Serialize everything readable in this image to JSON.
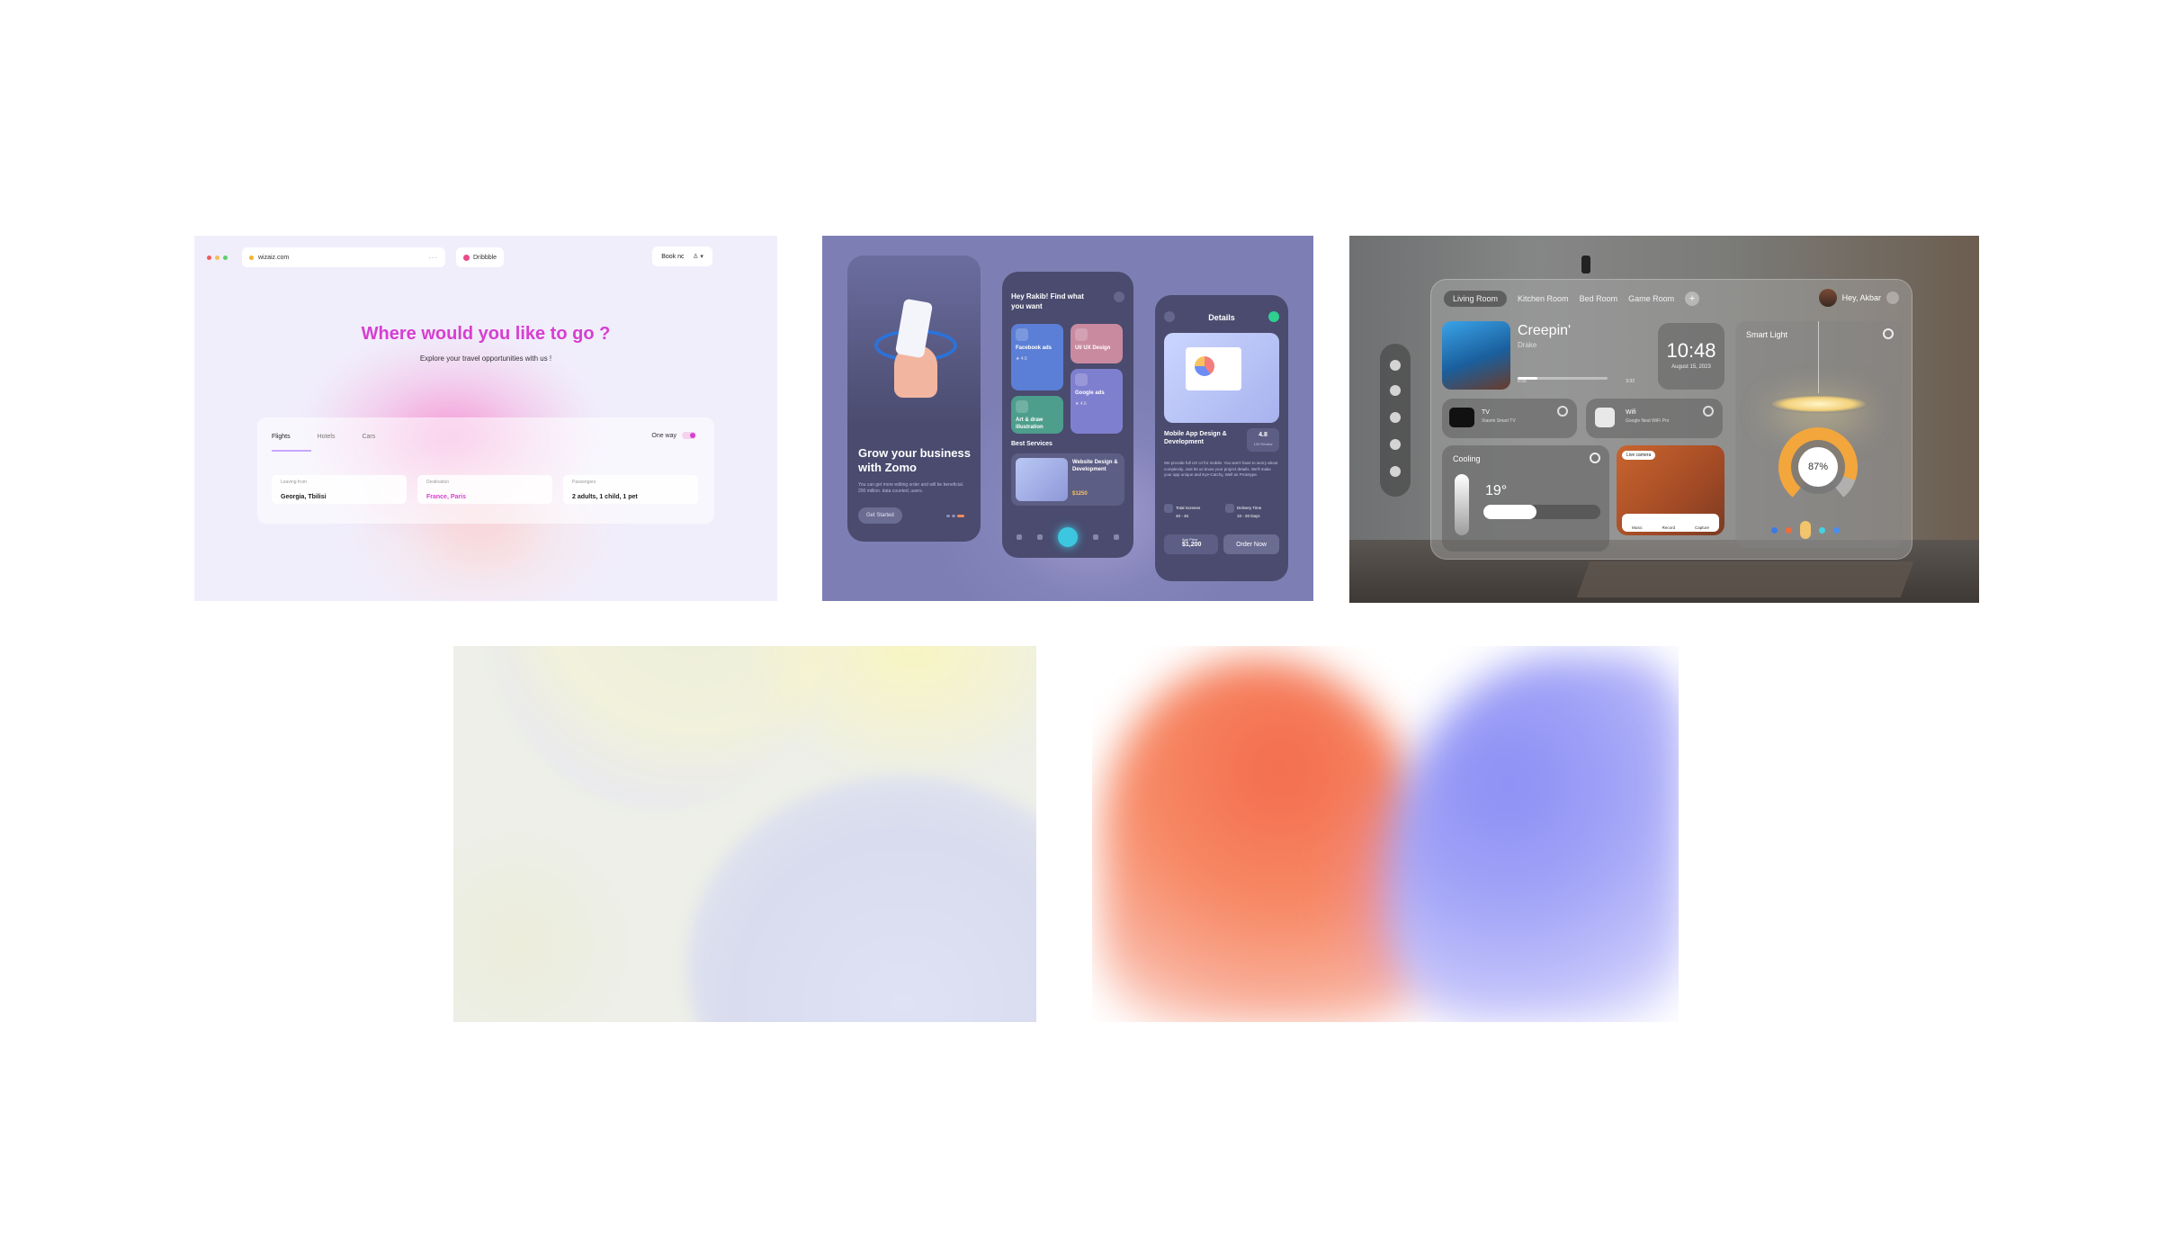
{
  "travel": {
    "window_dots": [
      "#f25b5b",
      "#f2c14e",
      "#5bcf6a"
    ],
    "url": "wizaiz.com",
    "dribbble_label": "Dribbble",
    "book_now": "Book now",
    "user_menu": "♙ ▾",
    "headline": "Where would you like to go ?",
    "subline": "Explore your travel opportunities with us !",
    "tabs": [
      "Flights",
      "Hotels",
      "Cars"
    ],
    "one_way": "One way",
    "fields": [
      {
        "label": "Leaving from",
        "value": "Georgia, Tbilisi"
      },
      {
        "label": "Destination",
        "value": "France, Paris"
      },
      {
        "label": "Passengers",
        "value": "2 adults, 1 child, 1 pet"
      }
    ],
    "accent": "#d63ed0"
  },
  "mobile": {
    "onboarding": {
      "title": "Grow your business with Zomo",
      "description": "You can get more editing order and will be beneficial. 200 million. data counted, users.",
      "cta": "Get Started"
    },
    "home": {
      "greeting": "Hey Rakib! Find what you want",
      "services": [
        {
          "name": "Facebook ads",
          "rating": "★ 4.6",
          "bg": "#5b7fd6"
        },
        {
          "name": "UI/ UX Design",
          "rating": "",
          "bg": "#c98aa0"
        },
        {
          "name": "Art & draw illustration",
          "rating": "",
          "bg": "#4d9e8c"
        },
        {
          "name": "Google ads",
          "rating": "★ 4.6",
          "bg": "#7f7fd0"
        }
      ],
      "best_services_title": "Best Services",
      "best_card": {
        "title": "Website Design & Development",
        "price": "$1250"
      }
    },
    "details": {
      "title": "Details",
      "service_name": "Mobile App Design & Development",
      "rating": "4.8",
      "rating_sub": "120 Review",
      "text": "We provide full UX UI for mobile. You won't have to worry about complexity. Just let us know your project details. We'll make your app unique and Eye-Catchy, Well as Prototype.",
      "total_screens": "Total Screens",
      "total_screens_val": "40 - 45",
      "delivery": "Delivery Time",
      "delivery_val": "10 - 20 Days",
      "price_label": "App Price",
      "price": "$1,200",
      "order": "Order Now"
    }
  },
  "smarthome": {
    "rooms": [
      "Living Room",
      "Kitchen Room",
      "Bed Room",
      "Game Room"
    ],
    "add": "+",
    "greeting": "Hey, Akbar",
    "music": {
      "song": "Creepin'",
      "artist": "Drake",
      "elapsed": "0:35",
      "total": "3:32",
      "progress": 0.22
    },
    "clock": {
      "time": "10:48",
      "date": "August 15, 2023"
    },
    "tv": {
      "name": "TV",
      "model": "Xiaomi Smart TV"
    },
    "wifi": {
      "name": "Wifi",
      "model": "Google Nest WiFi Pro"
    },
    "cooling": {
      "label": "Cooling",
      "temp": "19°",
      "level": 0.45
    },
    "camera": {
      "badge": "Live camera",
      "actions": [
        "Music",
        "Record",
        "Capture"
      ]
    },
    "light": {
      "label": "Smart Light",
      "brightness": "87%",
      "swatches": [
        "#3b7be8",
        "#ef6c3a",
        "#f2c46b",
        "#43d3e0",
        "#4a8df0"
      ]
    }
  }
}
